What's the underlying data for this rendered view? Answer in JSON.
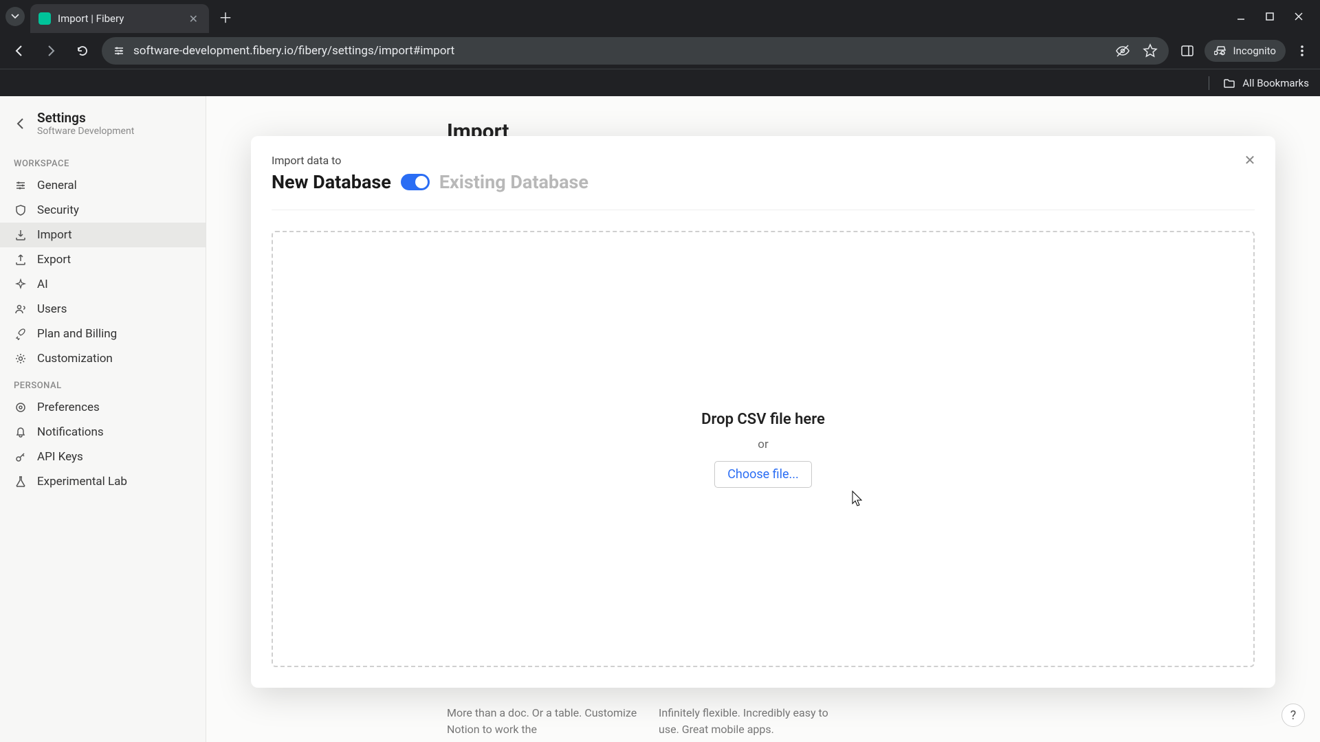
{
  "browser": {
    "tab_title": "Import | Fibery",
    "url": "software-development.fibery.io/fibery/settings/import#import",
    "incognito_label": "Incognito",
    "all_bookmarks": "All Bookmarks"
  },
  "sidebar": {
    "title": "Settings",
    "subtitle": "Software Development",
    "sections": {
      "workspace": "WORKSPACE",
      "personal": "PERSONAL"
    },
    "workspace_items": [
      {
        "label": "General"
      },
      {
        "label": "Security"
      },
      {
        "label": "Import"
      },
      {
        "label": "Export"
      },
      {
        "label": "AI"
      },
      {
        "label": "Users"
      },
      {
        "label": "Plan and Billing"
      },
      {
        "label": "Customization"
      }
    ],
    "personal_items": [
      {
        "label": "Preferences"
      },
      {
        "label": "Notifications"
      },
      {
        "label": "API Keys"
      },
      {
        "label": "Experimental Lab"
      }
    ]
  },
  "page": {
    "title": "Import",
    "snippet_left": "More than a doc. Or a table. Customize Notion to work the",
    "snippet_right": "Infinitely flexible. Incredibly easy to use. Great mobile apps."
  },
  "modal": {
    "label": "Import data to",
    "option_new": "New Database",
    "option_existing": "Existing Database",
    "drop_title": "Drop CSV file here",
    "drop_or": "or",
    "choose_file": "Choose file..."
  },
  "help": "?"
}
